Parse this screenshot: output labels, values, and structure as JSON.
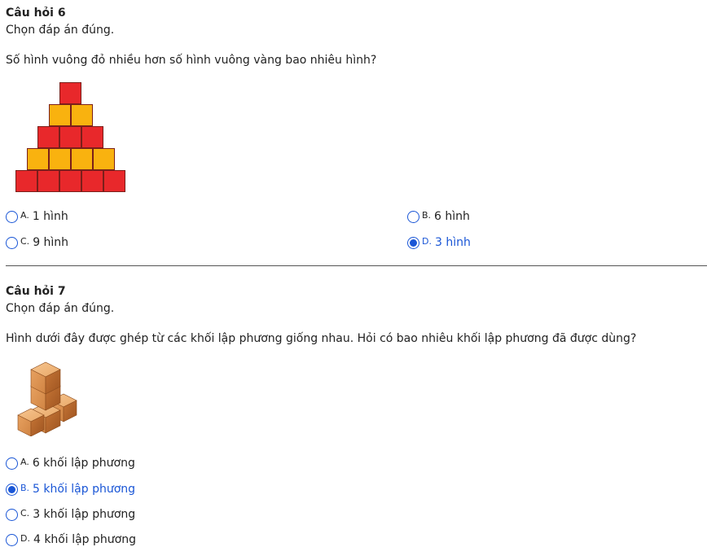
{
  "q6": {
    "title": "Câu hỏi 6",
    "instruction": "Chọn đáp án đúng.",
    "question": "Số hình vuông đỏ nhiều hơn số hình vuông vàng bao nhiêu hình?",
    "options": [
      {
        "letter": "A.",
        "text": "1 hình",
        "selected": false
      },
      {
        "letter": "B.",
        "text": "6 hình",
        "selected": false
      },
      {
        "letter": "C.",
        "text": "9 hình",
        "selected": false
      },
      {
        "letter": "D.",
        "text": "3 hình",
        "selected": true
      }
    ],
    "pyramid_rows": [
      {
        "color": "red",
        "count": 1
      },
      {
        "color": "yellow",
        "count": 2
      },
      {
        "color": "red",
        "count": 3
      },
      {
        "color": "yellow",
        "count": 4
      },
      {
        "color": "red",
        "count": 5
      }
    ]
  },
  "q7": {
    "title": "Câu hỏi 7",
    "instruction": "Chọn đáp án đúng.",
    "question": "Hình dưới đây được ghép từ các khối lập phương giống nhau. Hỏi có bao nhiêu khối lập phương đã được dùng?",
    "options": [
      {
        "letter": "A.",
        "text": "6 khối lập phương",
        "selected": false
      },
      {
        "letter": "B.",
        "text": "5 khối lập phương",
        "selected": true
      },
      {
        "letter": "C.",
        "text": "3 khối lập phương",
        "selected": false
      },
      {
        "letter": "D.",
        "text": "4 khối lập phương",
        "selected": false
      }
    ]
  },
  "colors": {
    "accent": "#1a56d6",
    "red_square": "#e8282b",
    "yellow_square": "#f9b20f",
    "cube_light": "#f0b577",
    "cube_dark": "#b8682c"
  }
}
